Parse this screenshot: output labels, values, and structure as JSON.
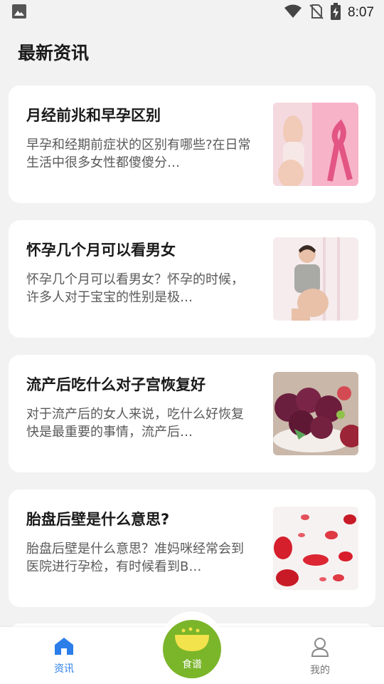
{
  "status_bar": {
    "time": "8:07",
    "icons": [
      "image-icon",
      "wifi-icon",
      "no-sim-icon",
      "battery-charging-icon"
    ]
  },
  "page": {
    "title": "最新资讯"
  },
  "articles": [
    {
      "title": "月经前兆和早孕区别",
      "summary": "早孕和经期前症状的区别有哪些?在日常生活中很多女性都傻傻分…",
      "thumbnail": "pink-ribbon-woman-image"
    },
    {
      "title": "怀孕几个月可以看男女",
      "summary": "怀孕几个月可以看男女？怀孕的时候，许多人对于宝宝的性别是极…",
      "thumbnail": "pregnant-woman-image"
    },
    {
      "title": "流产后吃什么对子宫恢复好",
      "summary": "对于流产后的女人来说，吃什么好恢复快是最重要的事情，流产后…",
      "thumbnail": "bayberry-fruit-image"
    },
    {
      "title": "胎盘后壁是什么意思?",
      "summary": "胎盘后壁是什么意思？准妈咪经常会到医院进行孕检，有时候看到B…",
      "thumbnail": "red-blood-cells-image"
    }
  ],
  "tab_bar": {
    "news_label": "资讯",
    "recipes_label": "食谱",
    "mine_label": "我的",
    "active_color": "#2b7de9",
    "center_color": "#7bb52a"
  }
}
